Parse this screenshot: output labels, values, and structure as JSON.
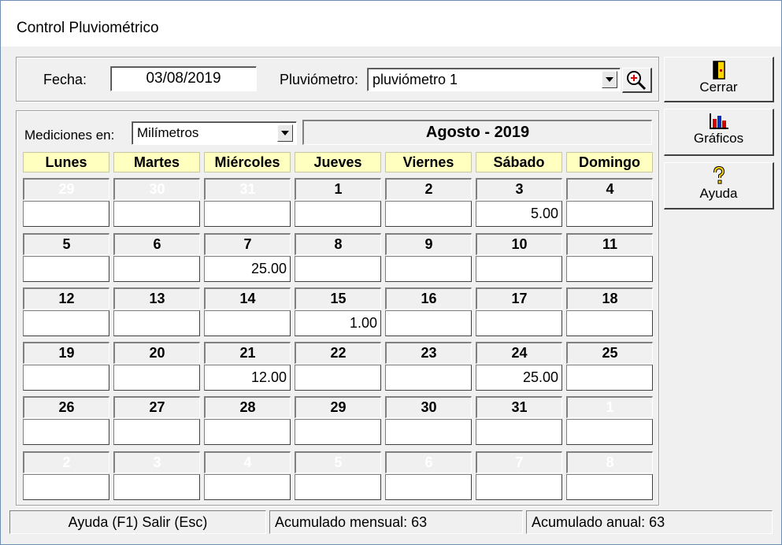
{
  "window": {
    "title": "Control Pluviométrico"
  },
  "header": {
    "fecha_label": "Fecha:",
    "fecha_value": "03/08/2019",
    "pluviometro_label": "Pluviómetro:",
    "pluviometro_value": "pluviómetro 1"
  },
  "calendar": {
    "mediciones_label": "Mediciones en:",
    "mediciones_value": "Milímetros",
    "month_title": "Agosto - 2019",
    "day_headers": [
      "Lunes",
      "Martes",
      "Miércoles",
      "Jueves",
      "Viernes",
      "Sábado",
      "Domingo"
    ],
    "weeks": [
      {
        "days": [
          {
            "num": "29",
            "value": "",
            "other": true
          },
          {
            "num": "30",
            "value": "",
            "other": true
          },
          {
            "num": "31",
            "value": "",
            "other": true
          },
          {
            "num": "1",
            "value": "",
            "other": false
          },
          {
            "num": "2",
            "value": "",
            "other": false
          },
          {
            "num": "3",
            "value": "5.00",
            "other": false
          },
          {
            "num": "4",
            "value": "",
            "other": false
          }
        ]
      },
      {
        "days": [
          {
            "num": "5",
            "value": "",
            "other": false
          },
          {
            "num": "6",
            "value": "",
            "other": false
          },
          {
            "num": "7",
            "value": "25.00",
            "other": false
          },
          {
            "num": "8",
            "value": "",
            "other": false
          },
          {
            "num": "9",
            "value": "",
            "other": false
          },
          {
            "num": "10",
            "value": "",
            "other": false
          },
          {
            "num": "11",
            "value": "",
            "other": false
          }
        ]
      },
      {
        "days": [
          {
            "num": "12",
            "value": "",
            "other": false
          },
          {
            "num": "13",
            "value": "",
            "other": false
          },
          {
            "num": "14",
            "value": "",
            "other": false
          },
          {
            "num": "15",
            "value": "1.00",
            "other": false
          },
          {
            "num": "16",
            "value": "",
            "other": false
          },
          {
            "num": "17",
            "value": "",
            "other": false
          },
          {
            "num": "18",
            "value": "",
            "other": false
          }
        ]
      },
      {
        "days": [
          {
            "num": "19",
            "value": "",
            "other": false
          },
          {
            "num": "20",
            "value": "",
            "other": false
          },
          {
            "num": "21",
            "value": "12.00",
            "other": false
          },
          {
            "num": "22",
            "value": "",
            "other": false
          },
          {
            "num": "23",
            "value": "",
            "other": false
          },
          {
            "num": "24",
            "value": "25.00",
            "other": false
          },
          {
            "num": "25",
            "value": "",
            "other": false
          }
        ]
      },
      {
        "days": [
          {
            "num": "26",
            "value": "",
            "other": false
          },
          {
            "num": "27",
            "value": "",
            "other": false
          },
          {
            "num": "28",
            "value": "",
            "other": false
          },
          {
            "num": "29",
            "value": "",
            "other": false
          },
          {
            "num": "30",
            "value": "",
            "other": false
          },
          {
            "num": "31",
            "value": "",
            "other": false
          },
          {
            "num": "1",
            "value": "",
            "other": true
          }
        ]
      },
      {
        "days": [
          {
            "num": "2",
            "value": "",
            "other": true
          },
          {
            "num": "3",
            "value": "",
            "other": true
          },
          {
            "num": "4",
            "value": "",
            "other": true
          },
          {
            "num": "5",
            "value": "",
            "other": true
          },
          {
            "num": "6",
            "value": "",
            "other": true
          },
          {
            "num": "7",
            "value": "",
            "other": true
          },
          {
            "num": "8",
            "value": "",
            "other": true
          }
        ]
      }
    ]
  },
  "sidebar": {
    "buttons": [
      {
        "label": "Cerrar",
        "icon": "door-exit-icon"
      },
      {
        "label": "Gráficos",
        "icon": "bar-chart-icon"
      },
      {
        "label": "Ayuda",
        "icon": "question-mark-icon"
      }
    ]
  },
  "statusbar": {
    "keys": "Ayuda (F1)  Salir (Esc)",
    "monthly": "Acumulado mensual: 63",
    "annual": "Acumulado anual: 63"
  },
  "colors": {
    "header_bg": "#ffffc0",
    "other_month_text": "#ffffff"
  }
}
